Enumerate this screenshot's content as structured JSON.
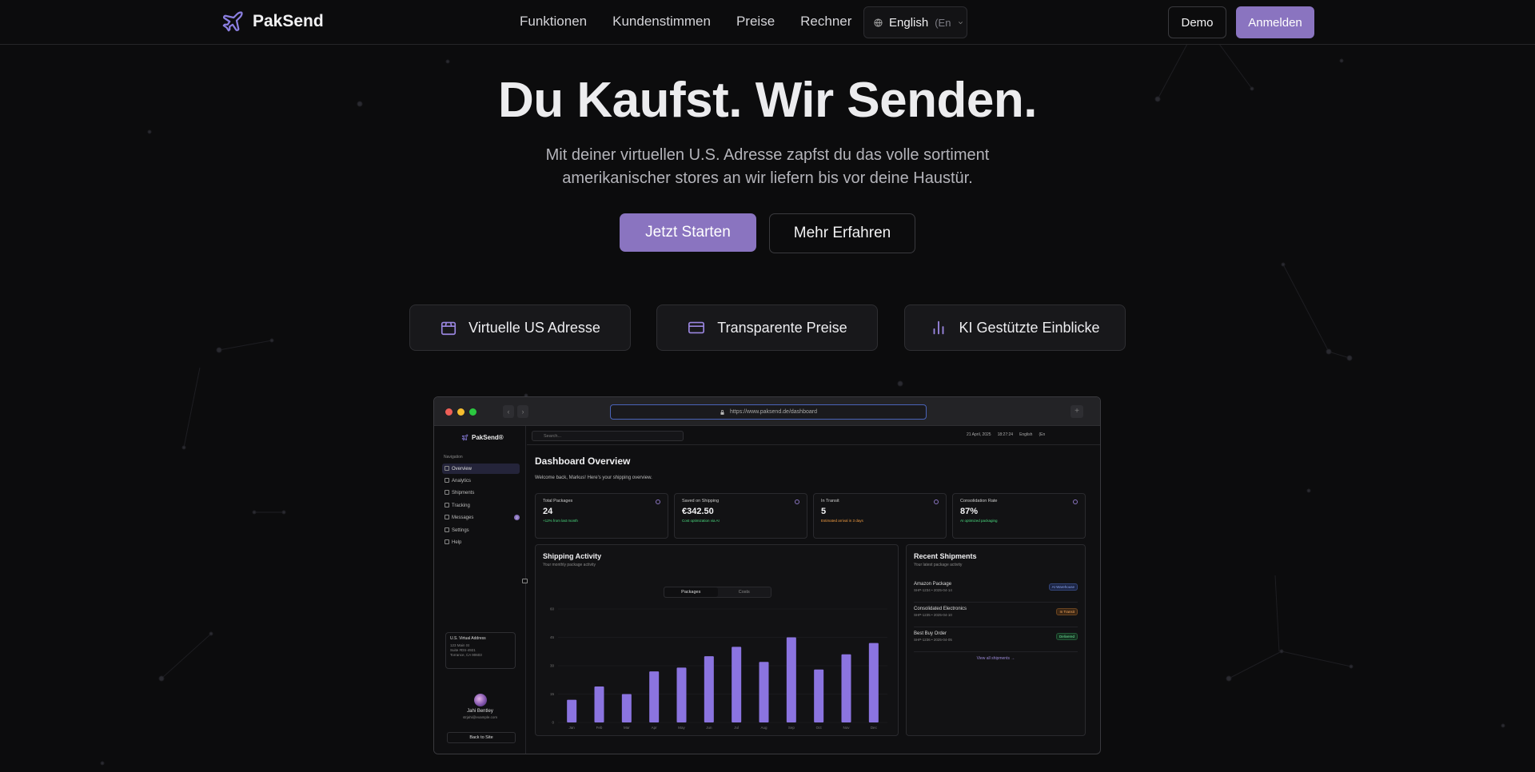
{
  "brand": {
    "name": "PakSend",
    "accent": "#8a74c0"
  },
  "nav": {
    "links": [
      "Funktionen",
      "Kundenstimmen",
      "Preise",
      "Rechner"
    ],
    "language": {
      "label": "English",
      "sub": "(En",
      "icon": "globe-icon"
    },
    "demo_label": "Demo",
    "login_label": "Anmelden"
  },
  "hero": {
    "title": "Du Kaufst. Wir Senden.",
    "subtitle": "Mit deiner virtuellen U.S. Adresse zapfst du das volle sortiment amerikanischer stores an wir liefern bis vor deine Haustür.",
    "cta_primary": "Jetzt Starten",
    "cta_secondary": "Mehr Erfahren"
  },
  "features": [
    {
      "label": "Virtuelle US Adresse",
      "icon": "package-icon"
    },
    {
      "label": "Transparente Preise",
      "icon": "credit-card-icon"
    },
    {
      "label": "KI Gestützte Einblicke",
      "icon": "bar-chart-icon"
    }
  ],
  "preview": {
    "url": "https://www.paksend.de/dashboard",
    "sidebar": {
      "brand": "PakSend®",
      "caption": "Navigation",
      "items": [
        "Overview",
        "Analytics",
        "Shipments",
        "Tracking",
        "Messages",
        "Settings",
        "Help"
      ],
      "messages_count": "2",
      "address": {
        "title": "U.S. Virtual Address",
        "lines": [
          "123 Main St",
          "Suite #DS-4921",
          "Torrance, CA 90603"
        ]
      },
      "user_name": "Jahi Bentley",
      "user_email": "strjahi@example.com",
      "back_label": "Back to Site"
    },
    "topbar": {
      "search_placeholder": "Search...",
      "date": "21 April, 2025",
      "time": "18:27:24",
      "language": "English",
      "language_sub": "(En"
    },
    "title": "Dashboard Overview",
    "welcome": "Welcome back, Markus! Here's your shipping overview.",
    "stats": [
      {
        "label": "Total Packages",
        "value": "24",
        "note": "+12% from last month",
        "color": "#4ade80"
      },
      {
        "label": "Saved on Shipping",
        "value": "€342.50",
        "note": "Cost optimization via AI",
        "color": "#4ade80"
      },
      {
        "label": "In Transit",
        "value": "5",
        "note": "Estimated arrival in 3 days",
        "color": "#f59e42"
      },
      {
        "label": "Consolidation Rate",
        "value": "87%",
        "note": "AI optimized packaging",
        "color": "#4ade80"
      }
    ],
    "activity": {
      "title": "Shipping Activity",
      "subtitle": "Your monthly package activity",
      "tabs": [
        "Packages",
        "Costs"
      ]
    },
    "recent": {
      "title": "Recent Shipments",
      "subtitle": "Your latest package activity",
      "items": [
        {
          "name": "Amazon Package",
          "meta": "SHP-1234 • 2025-04-14",
          "status": "At Warehouse",
          "color": "#6b8de8"
        },
        {
          "name": "Consolidated Electronics",
          "meta": "SHP-1235 • 2025-04-10",
          "status": "In Transit",
          "color": "#f59e42"
        },
        {
          "name": "Best Buy Order",
          "meta": "SHP-1236 • 2025-04-05",
          "status": "Delivered",
          "color": "#4ade80"
        }
      ],
      "view_all": "View all shipments →"
    }
  },
  "chart_data": {
    "type": "bar",
    "categories": [
      "Jan",
      "Feb",
      "Mar",
      "Apr",
      "May",
      "Jun",
      "Jul",
      "Aug",
      "Sep",
      "Oct",
      "Nov",
      "Dec"
    ],
    "values": [
      12,
      19,
      15,
      27,
      29,
      35,
      40,
      32,
      45,
      28,
      36,
      42
    ],
    "yticks": [
      0,
      15,
      30,
      45,
      60
    ],
    "ylim": [
      0,
      60
    ],
    "grid": true,
    "title": "",
    "xlabel": "",
    "ylabel": ""
  }
}
